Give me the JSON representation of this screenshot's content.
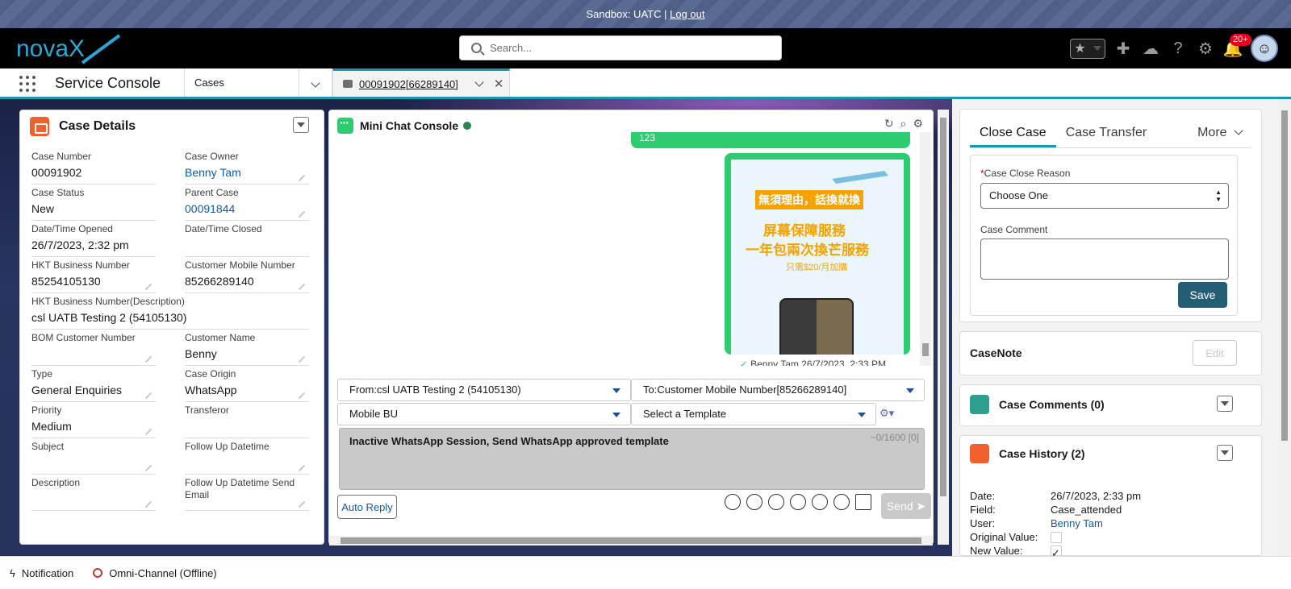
{
  "sandbox": {
    "label": "Sandbox: UATC |",
    "logout": "Log out"
  },
  "header": {
    "logo": "novaX",
    "search_placeholder": "Search...",
    "notif_badge": "20+"
  },
  "nav": {
    "app_name": "Service Console",
    "tab_cases": "Cases",
    "active_tab": "00091902[66289140]"
  },
  "case_details": {
    "title": "Case Details",
    "fields": [
      {
        "label": "Case Number",
        "value": "00091902"
      },
      {
        "label": "Case Owner",
        "value": "Benny Tam"
      },
      {
        "label": "Case Status",
        "value": "New"
      },
      {
        "label": "Parent Case",
        "value": "00091844"
      },
      {
        "label": "Date/Time Opened",
        "value": "26/7/2023, 2:32 pm"
      },
      {
        "label": "Date/Time Closed",
        "value": ""
      },
      {
        "label": "HKT Business Number",
        "value": "85254105130"
      },
      {
        "label": "Customer Mobile Number",
        "value": "85266289140"
      },
      {
        "label": "HKT Business Number(Description)",
        "value": "csl UATB Testing 2 (54105130)"
      },
      {
        "label": "BOM Customer Number",
        "value": ""
      },
      {
        "label": "Customer Name",
        "value": "Benny"
      },
      {
        "label": "Type",
        "value": "General Enquiries"
      },
      {
        "label": "Case Origin",
        "value": "WhatsApp"
      },
      {
        "label": "Priority",
        "value": "Medium"
      },
      {
        "label": "Transferor",
        "value": ""
      },
      {
        "label": "Subject",
        "value": ""
      },
      {
        "label": "Follow Up Datetime",
        "value": ""
      },
      {
        "label": "Description",
        "value": ""
      },
      {
        "label": "Follow Up Datetime Send Email",
        "value": ""
      }
    ]
  },
  "chat": {
    "title": "Mini Chat Console",
    "bubble_text": "123",
    "image_banner": "無須理由，話換就換",
    "image_line1": "屏幕保障服務",
    "image_line2": "一年包兩次換芒服務",
    "image_line3": "只需$20/月加購",
    "meta": "Benny Tam,26/7/2023, 2:33 PM",
    "from": "From:csl UATB Testing 2 (54105130)",
    "to": "To:Customer Mobile Number[85266289140]",
    "bu": "Mobile BU",
    "template": "Select a Template",
    "message": "Inactive WhatsApp Session, Send WhatsApp approved template",
    "counter": "~0/1600 [0]",
    "auto_reply": "Auto Reply",
    "send": "Send"
  },
  "right_panel": {
    "tabs": [
      "Close Case",
      "Case Transfer",
      "More"
    ],
    "close_reason_label": "Case Close Reason",
    "close_reason_value": "Choose One",
    "comment_label": "Case Comment",
    "save": "Save",
    "casenote_title": "CaseNote",
    "edit": "Edit",
    "comments_title": "Case Comments (0)",
    "history_title": "Case History (2)",
    "history": {
      "date_label": "Date:",
      "date": "26/7/2023, 2:33 pm",
      "field_label": "Field:",
      "field": "Case_attended",
      "user_label": "User:",
      "user": "Benny Tam",
      "orig_label": "Original Value:",
      "new_label": "New Value:"
    }
  },
  "footer": {
    "notification": "Notification",
    "omni": "Omni-Channel (Offline)"
  },
  "colors": {
    "accent": "#1a98b0",
    "orange": "#f2612d",
    "green": "#2ecc71",
    "save": "#245e74"
  }
}
